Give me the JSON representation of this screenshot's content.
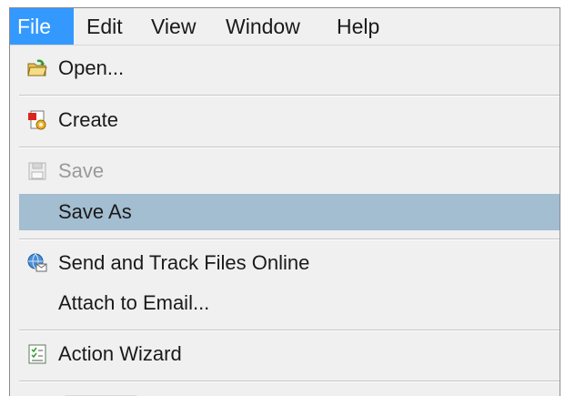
{
  "menubar": {
    "items": [
      {
        "label": "File",
        "active": true
      },
      {
        "label": "Edit"
      },
      {
        "label": "View"
      },
      {
        "label": "Window"
      },
      {
        "label": "Help"
      }
    ]
  },
  "file_menu": {
    "open": "Open...",
    "create": "Create",
    "save": "Save",
    "save_as": "Save As",
    "send_track": "Send and Track Files Online",
    "attach_email": "Attach to Email...",
    "action_wizard": "Action Wizard"
  },
  "icons": {
    "open": "open-folder-icon",
    "create": "create-pdf-icon",
    "save": "save-disk-icon",
    "send_track": "globe-envelope-icon",
    "action_wizard": "checklist-icon"
  },
  "colors": {
    "active_menu": "#3399ff",
    "highlight": "#a3bdd1",
    "menu_background": "#f0f0f0",
    "disabled_text": "#9a9a9a"
  }
}
